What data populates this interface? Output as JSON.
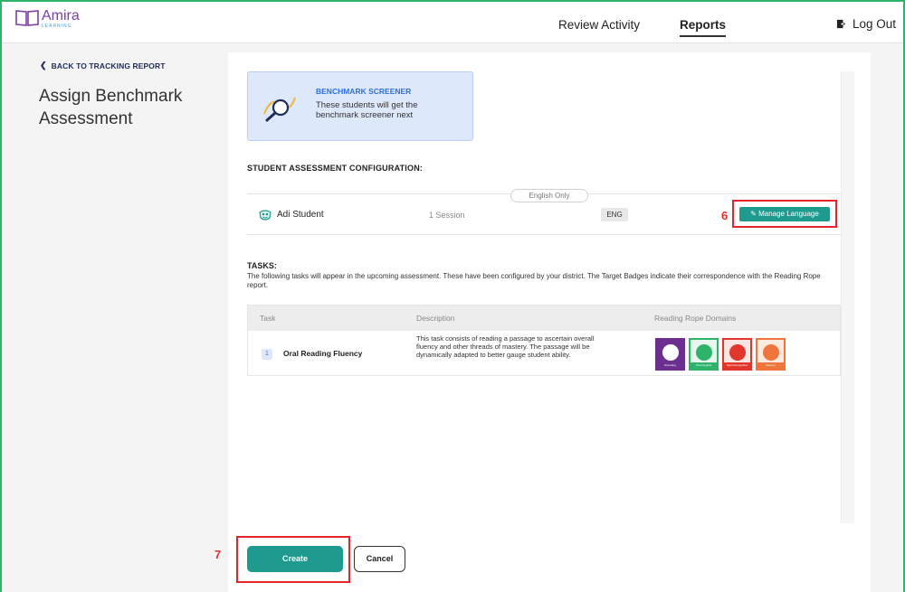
{
  "header": {
    "logo_name": "Amira",
    "logo_sub": "LEARNING",
    "nav": {
      "review_activity": "Review Activity",
      "reports": "Reports",
      "logout": "Log Out"
    }
  },
  "sidebar": {
    "back_link": "BACK TO TRACKING REPORT",
    "page_title": "Assign Benchmark Assessment"
  },
  "screener": {
    "title": "BENCHMARK SCREENER",
    "description": "These students will get the benchmark screener next"
  },
  "config": {
    "title": "STUDENT ASSESSMENT CONFIGURATION:",
    "language_pill": "English Only",
    "student": {
      "name": "Adi Student",
      "sessions": "1 Session",
      "language_code": "ENG"
    },
    "manage_language_label": "Manage Language",
    "annotation": "6"
  },
  "tasks": {
    "title": "TASKS:",
    "description": "The following tasks will appear in the upcoming assessment. These have been configured by your district. The Target Badges indicate their correspondence with the Reading Rope report.",
    "columns": [
      "Task",
      "Description",
      "Reading Rope Domains"
    ],
    "rows": [
      {
        "number": "1",
        "name": "Oral Reading Fluency",
        "description": "This task consists of reading a passage to ascertain overall fluency and other threads of mastery. The passage will be dynamically adapted to better gauge student ability.",
        "badges": [
          {
            "icon": "decoding-icon",
            "color": "#6b2f8f",
            "caption": "Decoding"
          },
          {
            "icon": "phonological-awareness-icon",
            "color": "#2fb36a",
            "caption": "Phonological Awareness"
          },
          {
            "icon": "sight-recognition-icon",
            "color": "#e0362c",
            "caption": "Sight Recognition"
          },
          {
            "icon": "fluency-icon",
            "color": "#f0753d",
            "caption": "Fluency"
          }
        ]
      }
    ]
  },
  "footer": {
    "create_label": "Create",
    "cancel_label": "Cancel",
    "annotation": "7"
  }
}
